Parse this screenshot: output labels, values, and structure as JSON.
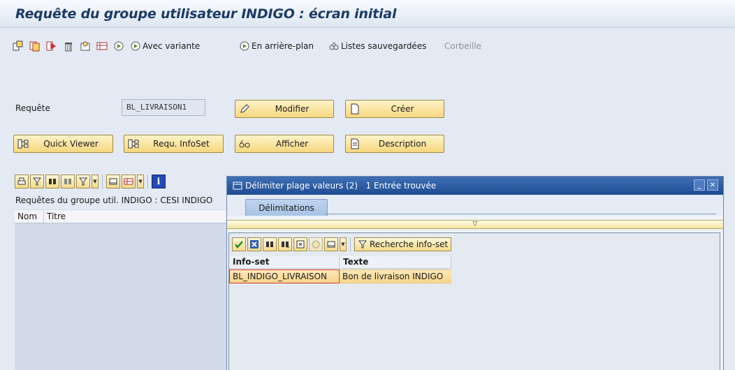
{
  "window": {
    "title": "Requête du groupe utilisateur INDIGO : écran initial"
  },
  "toolbar": {
    "icons": [
      "execute-icon",
      "copy-icon",
      "skip-icon",
      "delete-icon",
      "sort-icon",
      "print-icon",
      "execute-clock-icon"
    ],
    "avec_variante": "Avec variante",
    "en_arriere_plan": "En arrière-plan",
    "listes_sauvegardees": "Listes sauvegardées",
    "corbeille": "Corbeille"
  },
  "form": {
    "requete_label": "Requête",
    "requete_value": "BL_LIVRAISON1",
    "modifier": "Modifier",
    "creer": "Créer",
    "quick_viewer": "Quick Viewer",
    "requ_infoset": "Requ. InfoSet",
    "afficher": "Afficher",
    "description": "Description"
  },
  "list": {
    "title": "Requêtes du groupe util. INDIGO : CESI INDIGO",
    "columns": [
      "Nom",
      "Titre"
    ]
  },
  "popup": {
    "title": "Délimiter plage valeurs (2)   1 Entrée trouvée",
    "tab": "Délimitations",
    "search_button": "Recherche info-set",
    "columns": [
      "Info-set",
      "Texte"
    ],
    "rows": [
      {
        "infoset": "BL_INDIGO_LIVRAISON",
        "texte": "Bon de livraison INDIGO"
      }
    ]
  },
  "colors": {
    "title": "#1d3a66",
    "accent_button": "#f7d77e",
    "popup_header": "#1e4d93",
    "selection_border": "#d63a2b"
  }
}
